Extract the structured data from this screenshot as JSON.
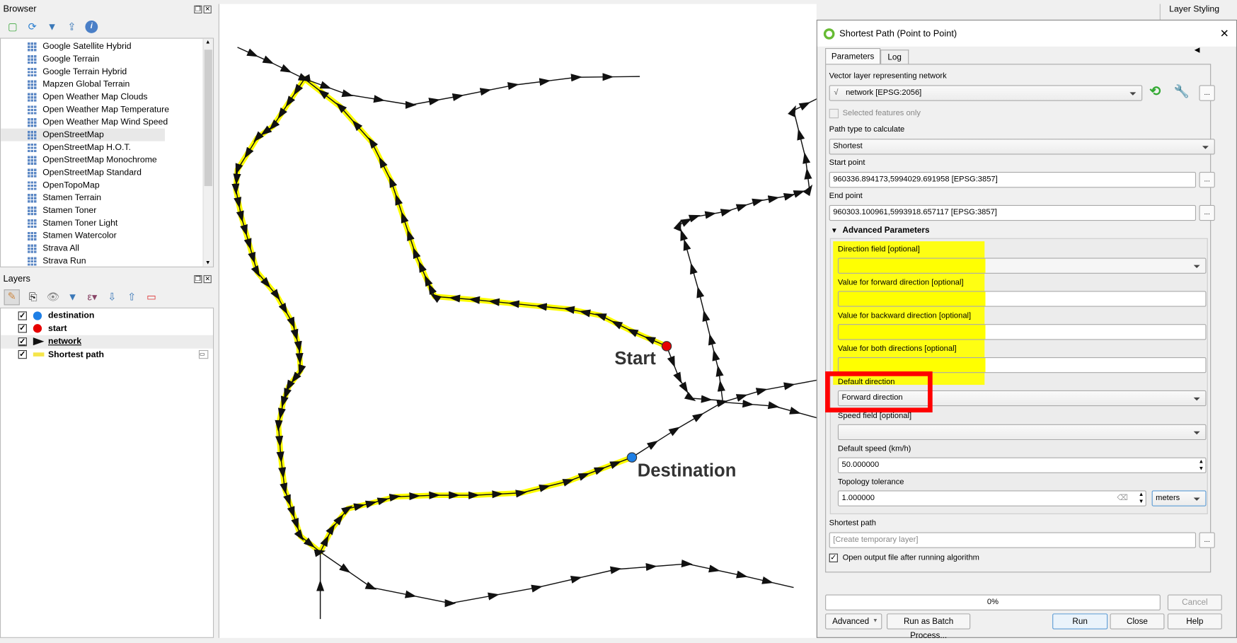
{
  "browser": {
    "title": "Browser",
    "items": [
      "Google Satellite Hybrid",
      "Google Terrain",
      "Google Terrain Hybrid",
      "Mapzen Global Terrain",
      "Open Weather Map Clouds",
      "Open Weather Map Temperature",
      "Open Weather Map Wind Speed",
      "OpenStreetMap",
      "OpenStreetMap H.O.T.",
      "OpenStreetMap Monochrome",
      "OpenStreetMap Standard",
      "OpenTopoMap",
      "Stamen Terrain",
      "Stamen Toner",
      "Stamen Toner Light",
      "Stamen Watercolor",
      "Strava All",
      "Strava Run"
    ],
    "selected": "OpenStreetMap"
  },
  "layers": {
    "title": "Layers",
    "items": [
      {
        "name": "destination",
        "color": "#1e7fe6",
        "checked": true
      },
      {
        "name": "start",
        "color": "#e60000",
        "checked": true
      },
      {
        "name": "network",
        "checked": true
      },
      {
        "name": "Shortest path",
        "color": "#f5e54a",
        "checked": true
      }
    ]
  },
  "map": {
    "start_label": "Start",
    "destination_label": "Destination",
    "path_color": "#ffff00"
  },
  "layer_styling": {
    "title": "Layer Styling"
  },
  "dialog": {
    "title": "Shortest Path (Point to Point)",
    "tabs": [
      "Parameters",
      "Log"
    ],
    "network_label": "Vector layer representing network",
    "network_value": "network [EPSG:2056]",
    "selected_only": "Selected features only",
    "path_type_label": "Path type to calculate",
    "path_type_value": "Shortest",
    "start_label": "Start point",
    "start_value": "960336.894173,5994029.691958 [EPSG:3857]",
    "end_label": "End point",
    "end_value": "960303.100961,5993918.657117 [EPSG:3857]",
    "advanced_label": "Advanced Parameters",
    "direction_field_label": "Direction field [optional]",
    "forward_label": "Value for forward direction [optional]",
    "backward_label": "Value for backward direction [optional]",
    "both_label": "Value for both directions [optional]",
    "default_direction_label": "Default direction",
    "default_direction_value": "Forward direction",
    "speed_field_label": "Speed field [optional]",
    "default_speed_label": "Default speed (km/h)",
    "default_speed_value": "50.000000",
    "tolerance_label": "Topology tolerance",
    "tolerance_value": "1.000000",
    "tolerance_unit": "meters",
    "output_label": "Shortest path",
    "output_placeholder": "[Create temporary layer]",
    "open_output": "Open output file after running algorithm",
    "open_output_checked": true,
    "progress": "0%",
    "progress_value": 0,
    "buttons": {
      "cancel": "Cancel",
      "advanced": "Advanced",
      "batch": "Run as Batch Process...",
      "run": "Run",
      "close": "Close",
      "help": "Help"
    },
    "ellipsis": "..."
  },
  "highlight_colors": {
    "yellow": "#ffff00",
    "red": "#ff0000"
  }
}
